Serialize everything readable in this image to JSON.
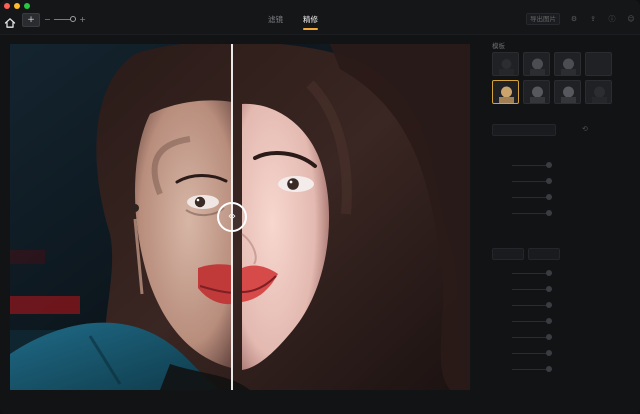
{
  "window": {
    "traffic_colors": [
      "#ff5f57",
      "#febc2e",
      "#28c840"
    ]
  },
  "toolbar": {
    "zoom_minus": "−",
    "zoom_plus": "+",
    "add_label": "+"
  },
  "tabs": [
    {
      "label": "滤镜",
      "active": false
    },
    {
      "label": "精修",
      "active": true
    }
  ],
  "right_actions": {
    "primary_label": "导出图片",
    "icons": [
      "sliders-icon",
      "share-icon",
      "info-icon",
      "user-icon"
    ]
  },
  "canvas": {
    "compare_mode": "split",
    "split_position": 0.48
  },
  "sidebar": {
    "title": "模板",
    "thumbnails_selected_index": 4,
    "button_label": "",
    "section1": "",
    "sliders1": [
      "",
      "",
      "",
      ""
    ],
    "section2": "",
    "mode_buttons": [
      "",
      ""
    ],
    "sliders2": [
      "",
      "",
      "",
      "",
      "",
      "",
      ""
    ]
  }
}
